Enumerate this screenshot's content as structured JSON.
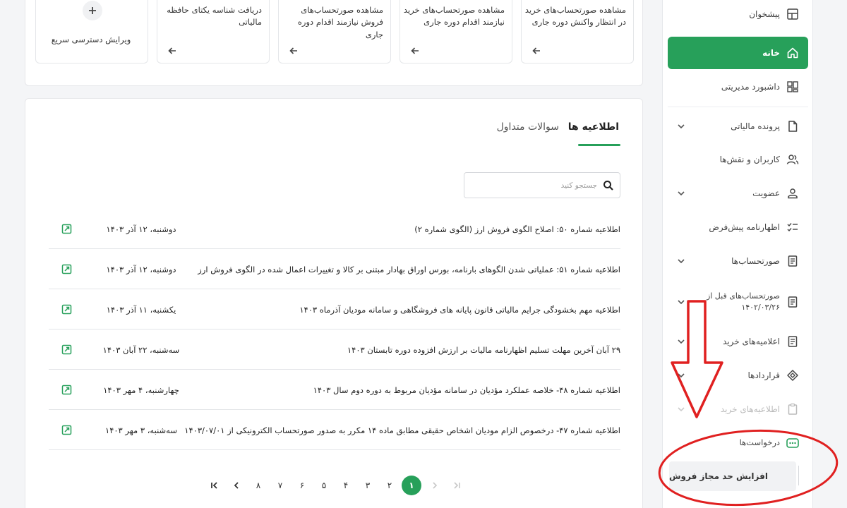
{
  "sidebar": {
    "items": [
      {
        "label": "پیشخوان",
        "icon": "dashboard-grid-icon"
      },
      {
        "label": "خانه",
        "icon": "home-icon"
      },
      {
        "label": "داشبورد مدیریتی",
        "icon": "management-dashboard-icon"
      },
      {
        "label": "پرونده مالیاتی",
        "icon": "file-icon"
      },
      {
        "label": "کاربران و نقش‌ها",
        "icon": "users-icon"
      },
      {
        "label": "عضویت",
        "icon": "person-icon"
      },
      {
        "label": "اظهارنامه پیش‌فرض",
        "icon": "checklist-icon"
      },
      {
        "label": "صورتحساب‌ها",
        "icon": "invoice-icon"
      },
      {
        "label": "صورتحساب‌های قبل از ۱۴۰۲/۰۳/۲۶",
        "icon": "invoice-old-icon"
      },
      {
        "label": "اعلامیه‌های خرید",
        "icon": "purchase-notice-icon"
      },
      {
        "label": "قراردادها",
        "icon": "contract-icon"
      },
      {
        "label": "اطلاعیه‌های خرید",
        "icon": "clipboard-icon"
      },
      {
        "label": "درخواست‌ها",
        "icon": "requests-icon"
      }
    ],
    "sub_item": "افزایش حد مجاز فروش"
  },
  "quick_cards": [
    {
      "text": "مشاهده صورتحساب‌های خرید در انتظار واکنش دوره جاری"
    },
    {
      "text": "مشاهده صورتحساب‌های خرید نیازمند اقدام دوره جاری"
    },
    {
      "text": "مشاهده صورتحساب‌های فروش نیازمند اقدام دوره جاری"
    },
    {
      "text": "دریافت شناسه یکتای حافظه مالیاتی"
    },
    {
      "text": "ویرایش دسترسی سریع"
    }
  ],
  "tabs": {
    "announcements": "اطلاعیه ها",
    "faq": "سوالات متداول"
  },
  "search": {
    "placeholder": "جستجو کنید",
    "value": ""
  },
  "announcements": [
    {
      "title": "اطلاعیه شماره ۵۰: اصلاح الگوی فروش ارز (الگوی شماره ۲)",
      "date": "دوشنبه، ۱۲ آذر ۱۴۰۳"
    },
    {
      "title": "اطلاعیه شماره ۵۱: عملیاتی شدن الگوهای بارنامه، بورس اوراق بهادار مبتنی بر کالا و تغییرات اعمال شده در الگوی فروش ارز",
      "date": "دوشنبه، ۱۲ آذر ۱۴۰۳"
    },
    {
      "title": "اطلاعیه مهم بخشودگی جرایم مالیاتی قانون پایانه های فروشگاهی و سامانه مودیان آذرماه ۱۴۰۳",
      "date": "یکشنبه، ۱۱ آذر ۱۴۰۳"
    },
    {
      "title": "۲۹ آبان آخرین مهلت تسلیم اظهارنامه مالیات بر ارزش افزوده دوره تابستان ۱۴۰۳",
      "date": "سه‌شنبه، ۲۲ آبان ۱۴۰۳"
    },
    {
      "title": "اطلاعیه شماره ۴۸- خلاصه عملکرد مؤدیان در سامانه مؤدیان مربوط به دوره دوم سال ۱۴۰۳",
      "date": "چهارشنبه، ۴ مهر ۱۴۰۳"
    },
    {
      "title": "اطلاعیه شماره ۴۷- درخصوص الزام مودیان اشخاص حقیقی مطابق ماده ۱۴ مکرر به صدور صورتحساب الکترونیکی از ۱۴۰۳/۰۷/۰۱",
      "date": "سه‌شنبه، ۳ مهر ۱۴۰۳"
    }
  ],
  "pagination": {
    "current": "۱",
    "pages": [
      "۲",
      "۳",
      "۴",
      "۵",
      "۶",
      "۷",
      "۸"
    ]
  },
  "colors": {
    "accent": "#27a05a",
    "annotation": "#e02020"
  }
}
